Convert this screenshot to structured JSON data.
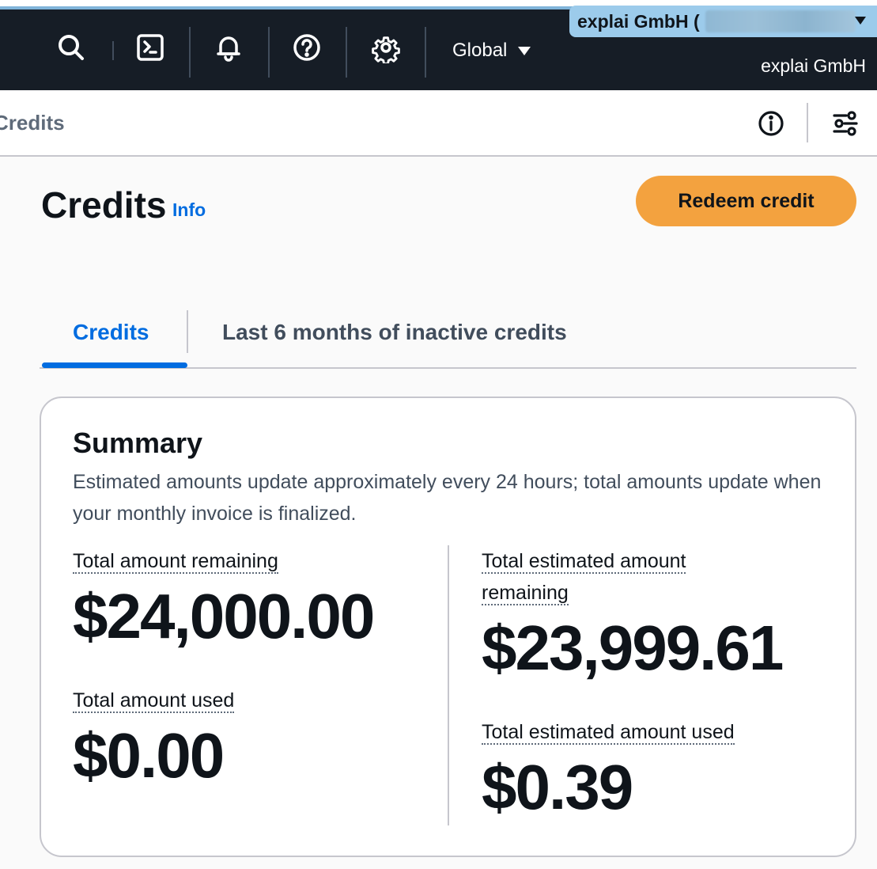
{
  "nav": {
    "region_label": "Global",
    "account_tab": "explai GmbH (",
    "account_name": "explai GmbH"
  },
  "breadcrumb": {
    "current": "Credits"
  },
  "page": {
    "title": "Credits",
    "info_link": "Info",
    "redeem_button": "Redeem credit"
  },
  "tabs": [
    {
      "label": "Credits",
      "active": true
    },
    {
      "label": "Last 6 months of inactive credits",
      "active": false
    }
  ],
  "summary": {
    "title": "Summary",
    "description": "Estimated amounts update approximately every 24 hours; total amounts update when your monthly invoice is finalized.",
    "total_remaining_label": "Total amount remaining",
    "total_remaining_value": "$24,000.00",
    "total_used_label": "Total amount used",
    "total_used_value": "$0.00",
    "est_remaining_label_line1": "Total estimated amount",
    "est_remaining_label_line2": "remaining",
    "est_remaining_value": "$23,999.61",
    "est_used_label": "Total estimated amount used",
    "est_used_value": "$0.39"
  },
  "colors": {
    "nav_bg": "#161d26",
    "accent_blue": "#006ce0",
    "button_orange": "#f3a23f",
    "account_tab_bg": "#9ccbeb"
  }
}
